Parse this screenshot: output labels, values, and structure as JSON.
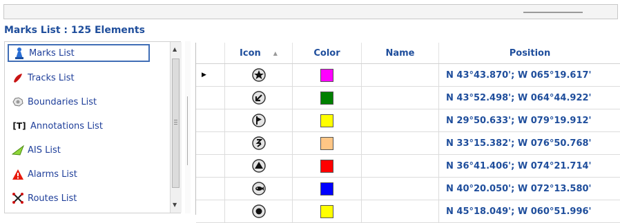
{
  "title": "Marks List : 125 Elements",
  "sidebar": {
    "items": [
      {
        "label": "Marks List",
        "icon": "marks-icon",
        "selected": true
      },
      {
        "label": "Tracks List",
        "icon": "tracks-icon"
      },
      {
        "label": "Boundaries List",
        "icon": "boundaries-icon"
      },
      {
        "label": "Annotations List",
        "icon": "annotations-icon"
      },
      {
        "label": "AIS List",
        "icon": "ais-icon"
      },
      {
        "label": "Alarms List",
        "icon": "alarms-icon"
      },
      {
        "label": "Routes List",
        "icon": "routes-icon"
      }
    ]
  },
  "grid": {
    "headers": {
      "icon": "Icon",
      "color": "Color",
      "name": "Name",
      "position": "Position"
    },
    "rows": [
      {
        "icon": "star-mark-icon",
        "color": "#ff00ff",
        "name": "",
        "position": "N 43°43.870'; W 065°19.617'"
      },
      {
        "icon": "diagonal-arrow-mark-icon",
        "color": "#008000",
        "name": "",
        "position": "N 43°52.498'; W 064°44.922'"
      },
      {
        "icon": "flag-mark-icon",
        "color": "#ffff00",
        "name": "",
        "position": "N 29°50.633'; W 079°19.912'"
      },
      {
        "icon": "hook-mark-icon",
        "color": "#ffc685",
        "name": "",
        "position": "N 33°15.382'; W 076°50.768'"
      },
      {
        "icon": "triangle-mark-icon",
        "color": "#ff0000",
        "name": "",
        "position": "N 36°41.406'; W 074°21.714'"
      },
      {
        "icon": "fish-mark-icon",
        "color": "#0000ff",
        "name": "",
        "position": "N 40°20.050'; W 072°13.580'"
      },
      {
        "icon": "dot-mark-icon",
        "color": "#ffff00",
        "name": "",
        "position": "N 45°18.049'; W 060°51.996'"
      }
    ]
  }
}
